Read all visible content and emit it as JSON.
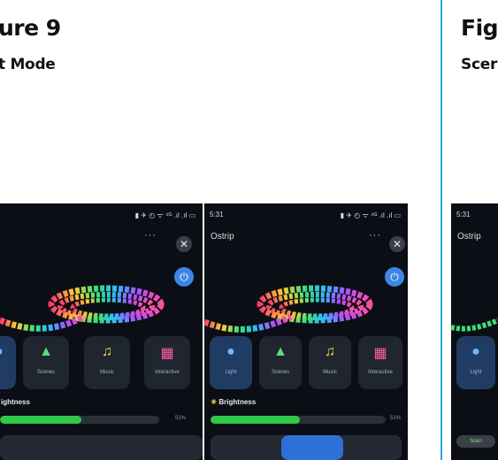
{
  "headings": {
    "left_title": "ure 9",
    "left_subtitle": "t Mode",
    "right_title": "Fig",
    "right_subtitle": "Scer"
  },
  "phone1": {
    "status_right": "▮ ✈ ◴ ᯤ ⁴ᴳ .ıl .ıl ▭",
    "title": "",
    "more": "···",
    "close_icon": "✕",
    "power_icon": "⏻",
    "modes": [
      {
        "label": "",
        "icon": "●",
        "color": "#6fb8ff"
      },
      {
        "label": "Scenes",
        "icon": "▲",
        "color": "#57e07a"
      },
      {
        "label": "Music",
        "icon": "♫",
        "color": "#ffd84a"
      },
      {
        "label": "Interactive",
        "icon": "▦",
        "color": "#ff5fa8"
      }
    ],
    "brightness_label": "ightness",
    "brightness_pct": "51%",
    "brightness_value": 0.51
  },
  "phone2": {
    "time": "5:31",
    "status_right": "▮ ✈ ◴ ᯤ ⁴ᴳ .ıl .ıl ▭",
    "title": "Ostrip",
    "more": "···",
    "close_icon": "✕",
    "power_icon": "⏻",
    "modes": [
      {
        "label": "Light",
        "icon": "💡",
        "color": "#6fb8ff"
      },
      {
        "label": "Scenes",
        "icon": "▲",
        "color": "#57e07a"
      },
      {
        "label": "Music",
        "icon": "♫",
        "color": "#ffd84a"
      },
      {
        "label": "Interactive",
        "icon": "▦",
        "color": "#ff5fa8"
      }
    ],
    "brightness_icon": "☀",
    "brightness_label": "Brightness",
    "brightness_pct": "51%",
    "brightness_value": 0.51
  },
  "phone3": {
    "time": "5:31",
    "title": "Ostrip",
    "light_label": "Light",
    "scenes_pill": "Scen"
  },
  "colors": {
    "divider": "#2aa3e6",
    "active_tile": "#213c62",
    "brightness_fill": "#31c94a",
    "power_button": "#3e86e6"
  }
}
